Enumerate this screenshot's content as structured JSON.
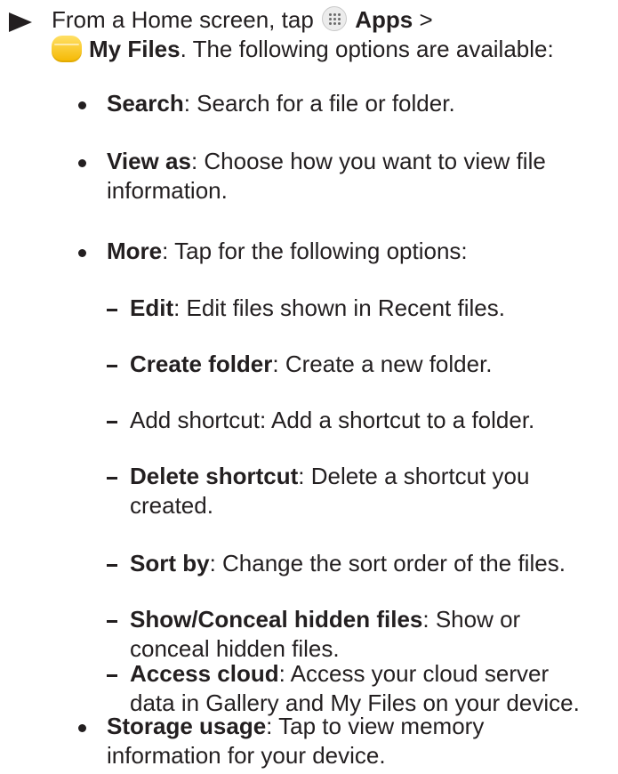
{
  "step": {
    "line1_prefix": "From a Home screen, tap",
    "apps_label": "Apps",
    "line1_suffix": ">",
    "myfiles_label": "My Files",
    "line2_suffix": ". The following options are available:"
  },
  "bullets": {
    "search": {
      "term": "Search",
      "desc": ": Search for a file or folder."
    },
    "view_as": {
      "term": "View as",
      "desc_line1": ": Choose how you want to view file",
      "desc_line2": "information."
    },
    "more": {
      "term": "More",
      "desc": ": Tap for the following options:"
    },
    "storage": {
      "term": "Storage usage",
      "desc_line1": ": Tap to view memory",
      "desc_line2": "information for your device."
    }
  },
  "sub_items": {
    "edit": {
      "term": "Edit",
      "desc": ": Edit files shown in Recent files."
    },
    "create_folder": {
      "term": "Create folder",
      "desc": ": Create a new folder."
    },
    "add_shortcut": {
      "text": "Add shortcut: Add a shortcut to a folder."
    },
    "delete_shortcut": {
      "term": "Delete shortcut",
      "desc_line1": ": Delete a shortcut you",
      "desc_line2": "created."
    },
    "sort_by": {
      "term": "Sort by",
      "desc": ": Change the sort order of the files."
    },
    "hidden_files": {
      "term": "Show/Conceal hidden files",
      "desc_line1": ": Show or",
      "desc_line2": "conceal hidden files."
    },
    "access_cloud": {
      "term": "Access cloud",
      "desc_line1": ": Access your cloud server",
      "desc_line2": "data in Gallery and My Files on your device."
    }
  },
  "icons": {
    "step_marker": "triangle-right-icon",
    "apps": "apps-grid-icon",
    "my_files": "folder-icon"
  },
  "colors": {
    "text": "#231f20",
    "folder": "#f5b800"
  }
}
